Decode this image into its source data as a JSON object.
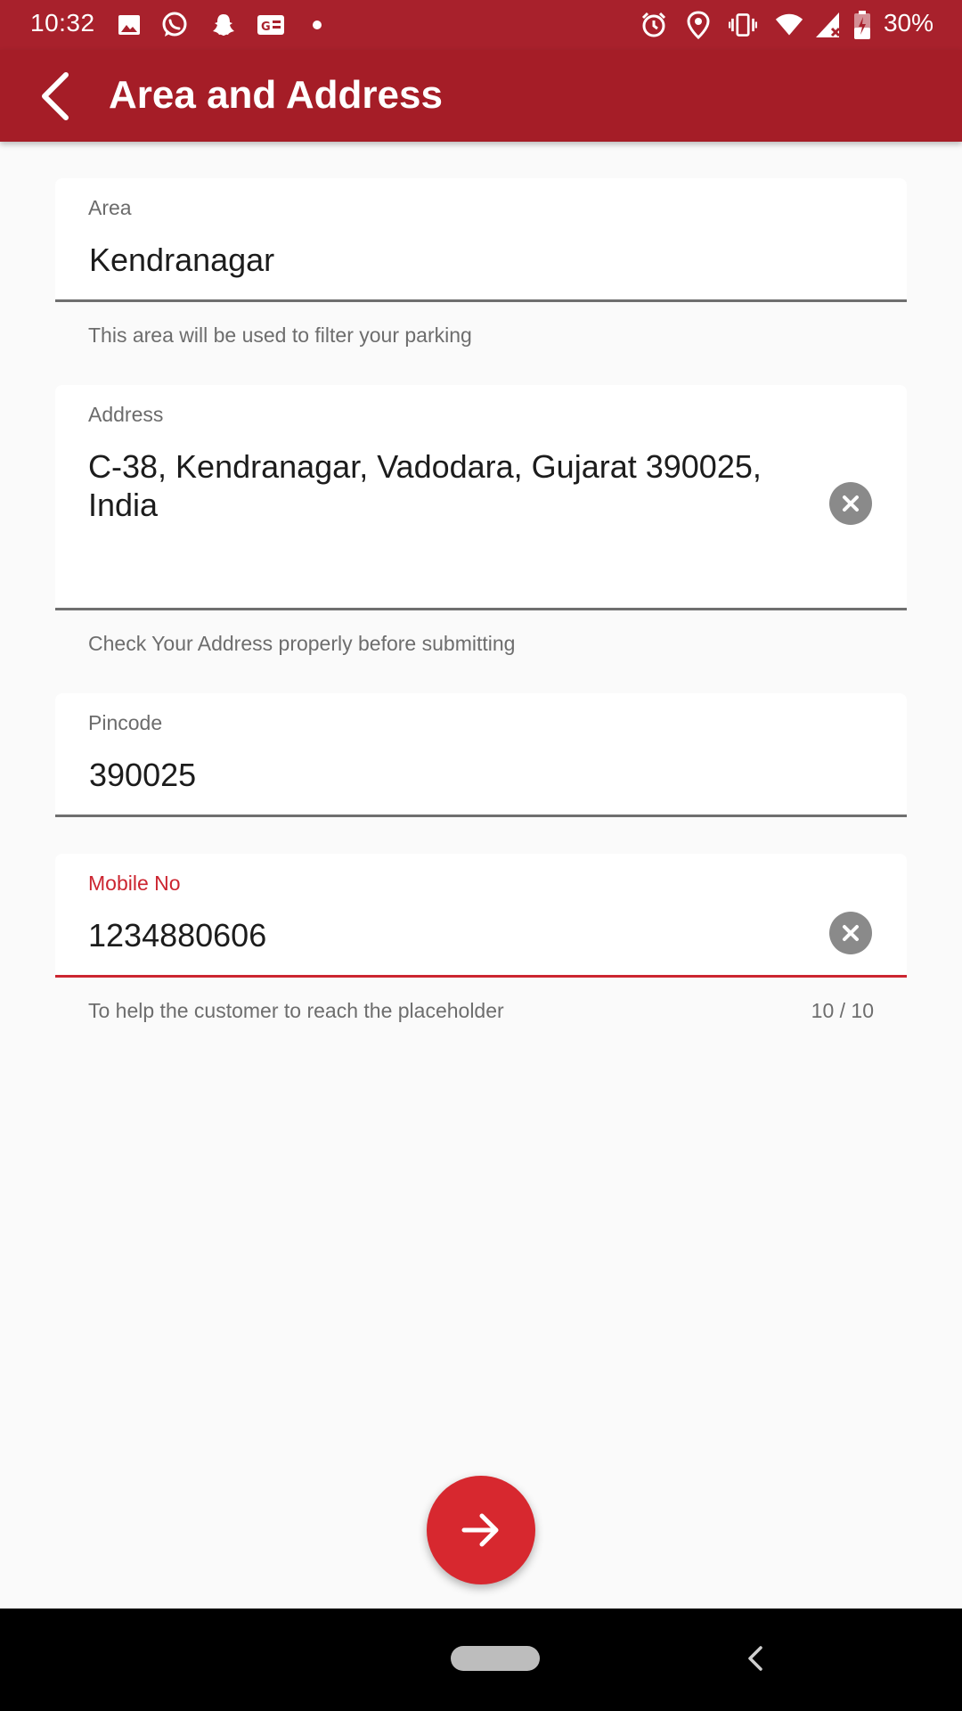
{
  "status_bar": {
    "time": "10:32",
    "battery": "30%",
    "left_icons": [
      "image-icon",
      "whatsapp-icon",
      "snapchat-icon",
      "news-icon",
      "dot-icon"
    ],
    "right_icons": [
      "alarm-icon",
      "location-icon",
      "vibrate-icon",
      "wifi-icon",
      "signal-icon",
      "battery-icon"
    ]
  },
  "app_bar": {
    "title": "Area and Address",
    "back_icon": "arrow-back-icon"
  },
  "form": {
    "area": {
      "label": "Area",
      "value": "Kendranagar",
      "helper": "This area will be used to filter your parking"
    },
    "address": {
      "label": "Address",
      "value_line1": "C-38, Kendranagar, Vadodara, Gujarat 390025,",
      "value_line2": "India",
      "helper": "Check Your Address properly before submitting",
      "clear_icon": "clear-icon"
    },
    "pincode": {
      "label": "Pincode",
      "value": "390025"
    },
    "mobile": {
      "label": "Mobile No",
      "value": "1234880606",
      "helper": "To help the customer to reach the placeholder",
      "counter": "10 / 10",
      "clear_icon": "clear-icon"
    }
  },
  "fab": {
    "icon": "arrow-forward-icon"
  },
  "colors": {
    "primary": "#a51d27",
    "accent": "#d7282f",
    "error": "#cc2530"
  }
}
